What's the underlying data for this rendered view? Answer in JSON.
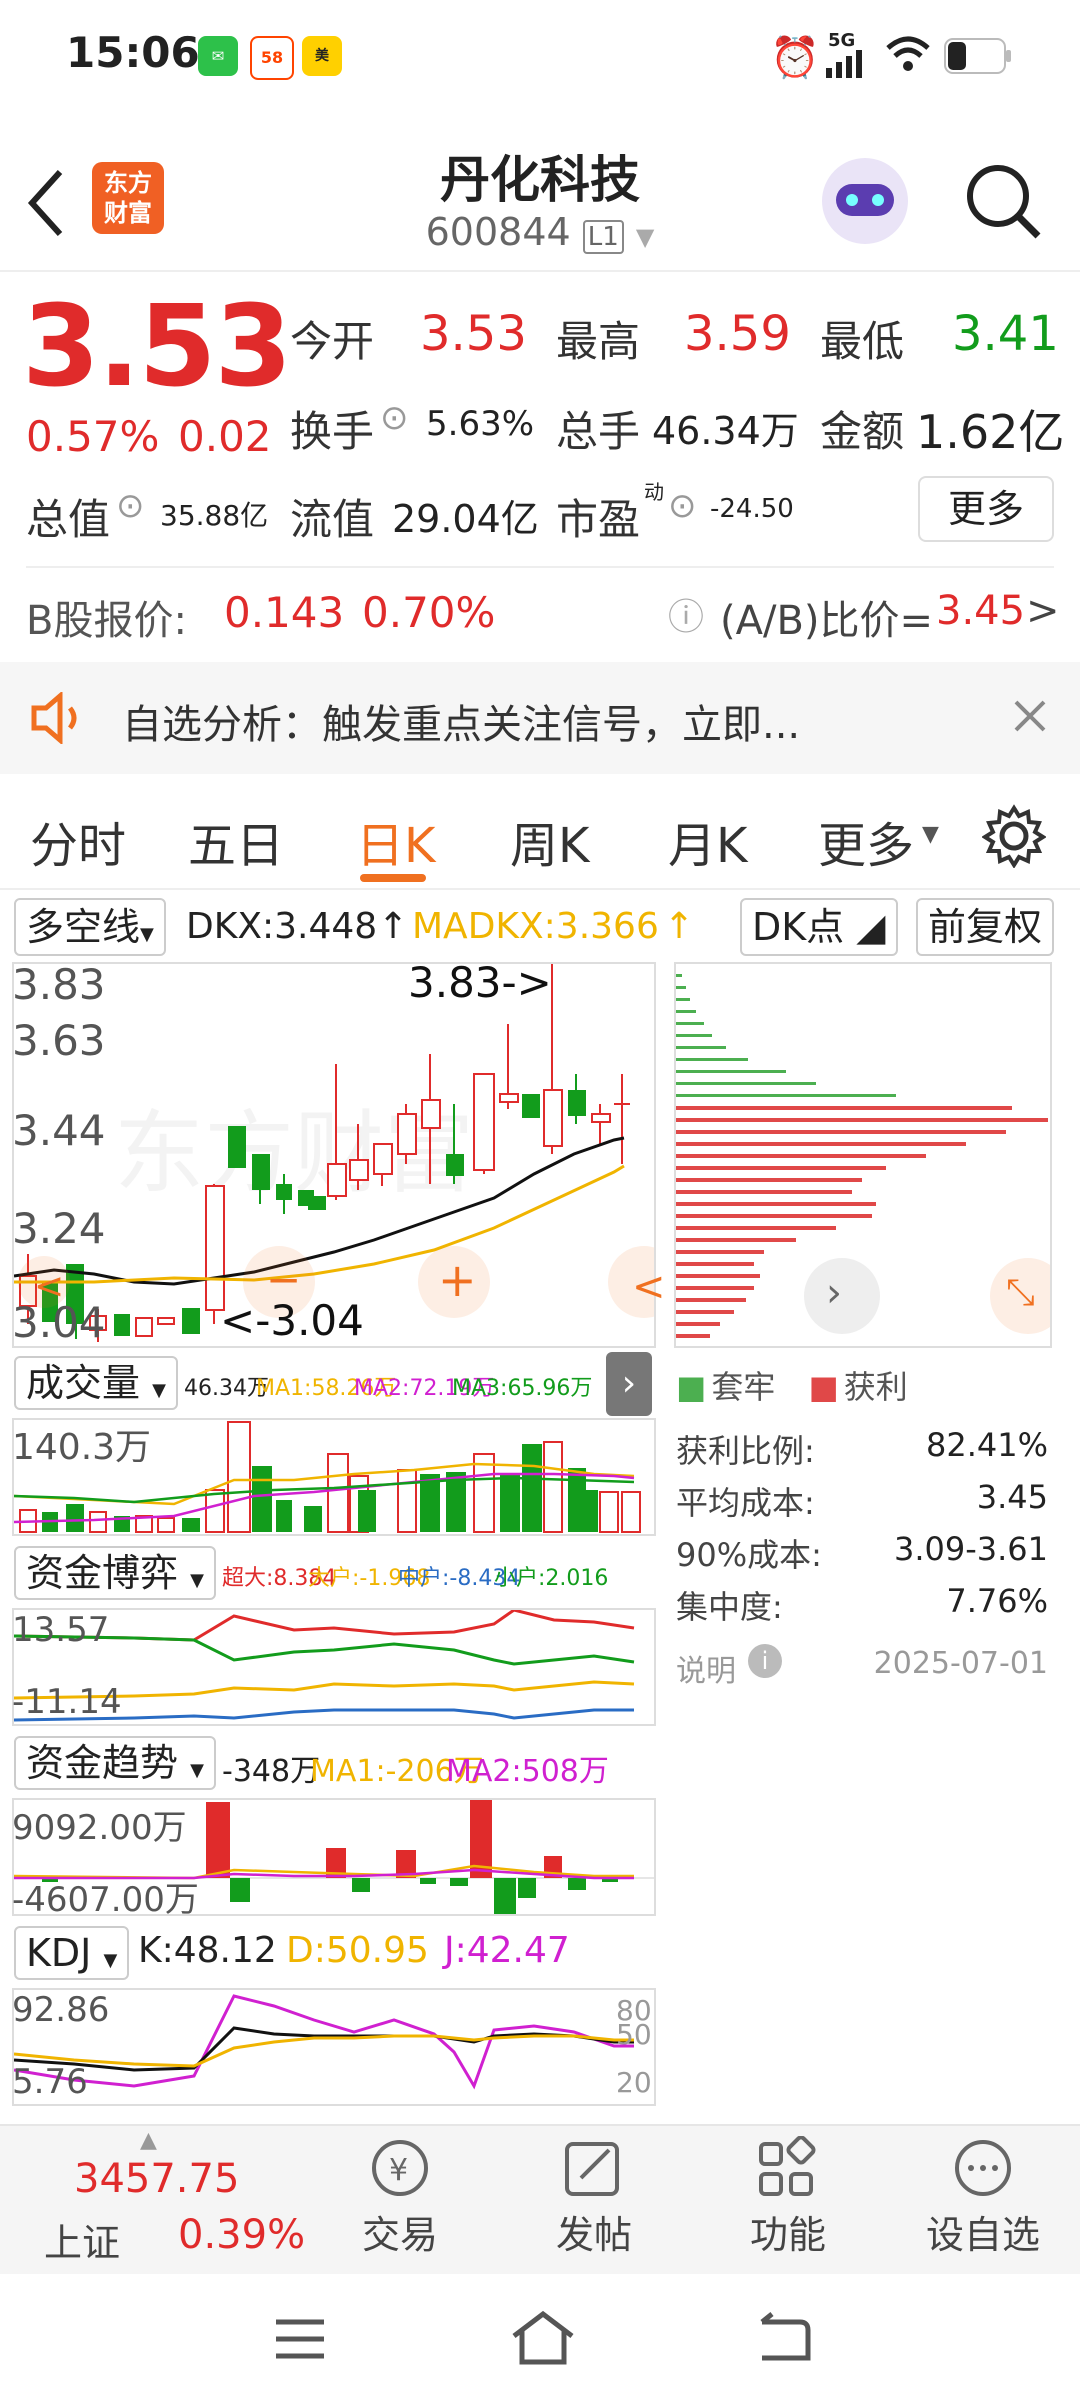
{
  "status_bar": {
    "time": "15:06",
    "network": "5G"
  },
  "header": {
    "title": "丹化科技",
    "code": "600844",
    "level_badge": "L1",
    "logo_line1": "东方",
    "logo_line2": "财富"
  },
  "quote": {
    "price": "3.53",
    "change_pct": "0.57%",
    "change": "0.02",
    "open_label": "今开",
    "open": "3.53",
    "high_label": "最高",
    "high": "3.59",
    "low_label": "最低",
    "low": "3.41",
    "turnover_label": "换手",
    "turnover": "5.63%",
    "volume_label": "总手",
    "volume": "46.34万",
    "amount_label": "金额",
    "amount": "1.62亿",
    "mktcap_label": "总值",
    "mktcap": "35.88亿",
    "float_label": "流值",
    "float_cap": "29.04亿",
    "pe_label": "市盈",
    "pe_sup": "动",
    "pe": "-24.50",
    "more_button": "更多"
  },
  "b_share": {
    "label": "B股报价:",
    "price": "0.143",
    "pct": "0.70%",
    "ratio_label": "(A/B)比价=",
    "ratio": "3.45",
    "arrow": ">"
  },
  "notice": {
    "text": "自选分析：触发重点关注信号，立即..."
  },
  "tabs": [
    {
      "label": "分时"
    },
    {
      "label": "五日"
    },
    {
      "label": "日K"
    },
    {
      "label": "周K"
    },
    {
      "label": "月K"
    },
    {
      "label": "更多"
    }
  ],
  "kline_panel": {
    "indicator_select": "多空线",
    "dkx": "DKX:3.448",
    "madkx": "MADKX:3.366",
    "dk_button": "DK点",
    "adjust_button": "前复权",
    "y_ticks": [
      "3.83",
      "3.63",
      "3.44",
      "3.24",
      "3.04"
    ],
    "max_annotation": "3.83->",
    "min_annotation": "<-3.04"
  },
  "volume_panel": {
    "select": "成交量",
    "vol": "46.34万",
    "ma1": "MA1:58.26万",
    "ma2": "MA2:72.19万",
    "ma3": "MA3:65.96万",
    "y_tick": "140.3万"
  },
  "capital_game_panel": {
    "select": "资金博弈",
    "super_large": "超大:8.384",
    "large": "大户:-1.968",
    "medium": "中户:-8.434",
    "small": "小户:2.016",
    "y_top": "13.57",
    "y_bottom": "-11.14"
  },
  "capital_trend_panel": {
    "select": "资金趋势",
    "value": "-348万",
    "ma1": "MA1:-206万",
    "ma2": "MA2:508万",
    "y_top": "9092.00万",
    "y_bottom": "-4607.00万"
  },
  "kdj_panel": {
    "select": "KDJ",
    "k": "K:48.12",
    "d": "D:50.95",
    "j": "J:42.47",
    "y_top": "92.86",
    "y_bottom": "5.76",
    "levels": [
      "80",
      "50",
      "20"
    ]
  },
  "chip_panel": {
    "legend_trapped": "套牢",
    "legend_profit": "获利",
    "rows": [
      {
        "label": "获利比例:",
        "value": "82.41%"
      },
      {
        "label": "平均成本:",
        "value": "3.45"
      },
      {
        "label": "90%成本:",
        "value": "3.09-3.61"
      },
      {
        "label": "集中度:",
        "value": "7.76%"
      }
    ],
    "note_label": "说明",
    "date": "2025-07-01"
  },
  "bottom_bar": {
    "index_value": "3457.75",
    "index_name": "上证",
    "index_pct": "0.39%",
    "items": [
      {
        "label": "交易"
      },
      {
        "label": "发帖"
      },
      {
        "label": "功能"
      },
      {
        "label": "设自选"
      }
    ]
  },
  "colors": {
    "up": "#e02b2b",
    "down": "#129c1c",
    "accent": "#f07020",
    "ma_yellow": "#f0b400",
    "ma_pink": "#d020d0"
  }
}
